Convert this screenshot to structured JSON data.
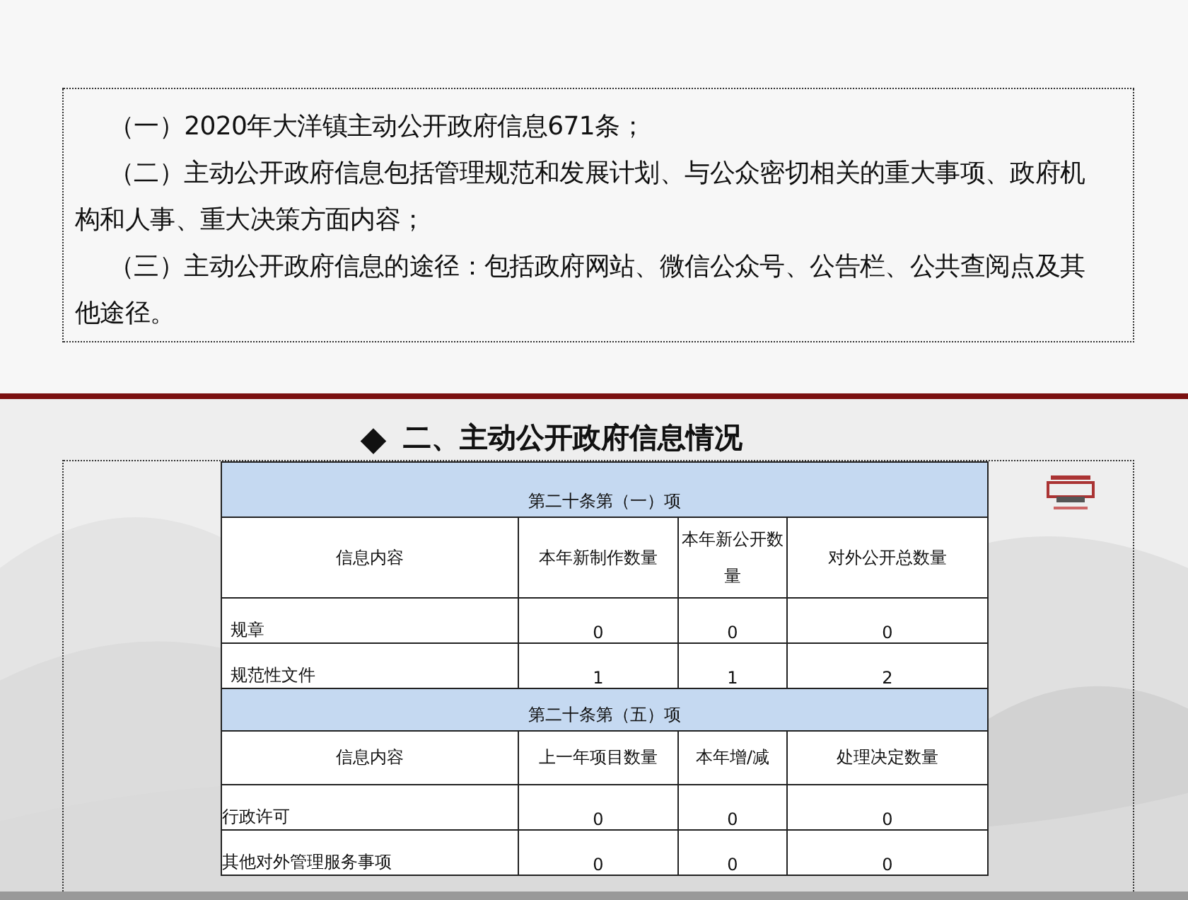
{
  "intro": [
    "（一）2020年大洋镇主动公开政府信息671条；",
    "（二）主动公开政府信息包括管理规范和发展计划、与公众密切相关的重大事项、政府机构和人事、重大决策方面内容；",
    "（三）主动公开政府信息的途径：包括政府网站、微信公众号、公告栏、公共查阅点及其他途径。"
  ],
  "heading": {
    "marker": "◆",
    "text": "二、主动公开政府信息情况"
  },
  "table": {
    "sections": [
      {
        "title": "第二十条第（一）项",
        "columns": [
          "信息内容",
          "本年新制作数量",
          "本年新公开数量",
          "对外公开总数量"
        ],
        "rows": [
          [
            "规章",
            "0",
            "0",
            "0"
          ],
          [
            "规范性文件",
            "1",
            "1",
            "2"
          ]
        ]
      },
      {
        "title": "第二十条第（五）项",
        "columns": [
          "信息内容",
          "上一年项目数量",
          "本年增/减",
          "处理决定数量"
        ],
        "rows": [
          [
            "行政许可",
            "0",
            "0",
            "0"
          ],
          [
            "其他对外管理服务事项",
            "0",
            "0",
            "0"
          ]
        ]
      }
    ]
  }
}
